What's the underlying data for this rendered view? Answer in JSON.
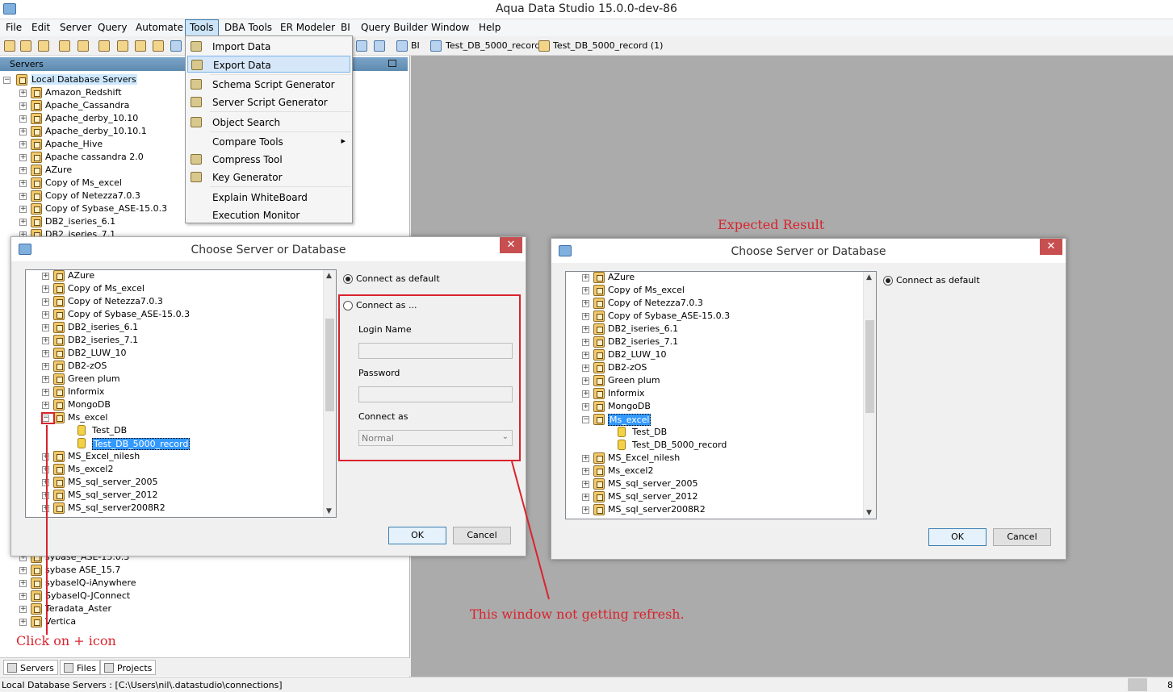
{
  "app": {
    "title": "Aqua Data Studio 15.0.0-dev-86"
  },
  "menubar": [
    "File",
    "Edit",
    "Server",
    "Query",
    "Automate",
    "Tools",
    "DBA Tools",
    "ER Modeler",
    "BI",
    "Query Builder",
    "Window",
    "Help"
  ],
  "toolbar": {
    "bi_label": "BI",
    "tab1": "Test_DB_5000_record",
    "tab2": "Test_DB_5000_record (1)"
  },
  "servers_panel": {
    "title": "Servers",
    "root": "Local Database Servers",
    "items_top": [
      "Amazon_Redshift",
      "Apache_Cassandra",
      "Apache_derby_10.10",
      "Apache_derby_10.10.1",
      "Apache_Hive",
      "Apache cassandra 2.0",
      "AZure",
      "Copy of Ms_excel",
      "Copy of Netezza7.0.3",
      "Copy of Sybase_ASE-15.0.3",
      "DB2_iseries_6.1",
      "DB2_iseries_7.1"
    ],
    "items_bottom": [
      "sybase_ASE-15.0.3",
      "sybase ASE_15.7",
      "sybaseIQ-iAnywhere",
      "SybaseIQ-JConnect",
      "Teradata_Aster",
      "Vertica"
    ]
  },
  "tools_menu": {
    "items": [
      "Import Data",
      "Export Data",
      "Schema Script Generator",
      "Server Script Generator",
      "Object Search",
      "Compare Tools",
      "Compress Tool",
      "Key Generator",
      "Explain WhiteBoard",
      "Execution Monitor"
    ],
    "submenu_arrow": "▸"
  },
  "dialog_left": {
    "title": "Choose Server or Database",
    "close": "✕",
    "tree": [
      "AZure",
      "Copy of Ms_excel",
      "Copy of Netezza7.0.3",
      "Copy of Sybase_ASE-15.0.3",
      "DB2_iseries_6.1",
      "DB2_iseries_7.1",
      "DB2_LUW_10",
      "DB2-zOS",
      "Green plum",
      "Informix",
      "MongoDB",
      "Ms_excel",
      "Test_DB",
      "Test_DB_5000_record",
      "MS_Excel_nilesh",
      "Ms_excel2",
      "MS_sql_server_2005",
      "MS_sql_server_2012",
      "MS_sql_server2008R2"
    ],
    "connect_default": "Connect as default",
    "connect_as": "Connect as ...",
    "login_label": "Login Name",
    "password_label": "Password",
    "connect_as_label": "Connect as",
    "connect_as_value": "Normal",
    "ok": "OK",
    "cancel": "Cancel"
  },
  "dialog_right": {
    "title": "Choose Server or Database",
    "close": "✕",
    "tree": [
      "AZure",
      "Copy of Ms_excel",
      "Copy of Netezza7.0.3",
      "Copy of Sybase_ASE-15.0.3",
      "DB2_iseries_6.1",
      "DB2_iseries_7.1",
      "DB2_LUW_10",
      "DB2-zOS",
      "Green plum",
      "Informix",
      "MongoDB",
      "Ms_excel",
      "Test_DB",
      "Test_DB_5000_record",
      "MS_Excel_nilesh",
      "Ms_excel2",
      "MS_sql_server_2005",
      "MS_sql_server_2012",
      "MS_sql_server2008R2"
    ],
    "connect_default": "Connect as default",
    "ok": "OK",
    "cancel": "Cancel"
  },
  "annotations": {
    "expected": "Expected Result",
    "click_plus": "Click on + icon",
    "not_refresh": "This window not getting refresh."
  },
  "bottom_tabs": [
    "Servers",
    "Files",
    "Projects"
  ],
  "status": {
    "path": "Local Database Servers : [C:\\Users\\nil\\.datastudio\\connections]",
    "right": "8"
  },
  "colors": {
    "annotation_red": "#d9232d",
    "selection": "#3399ff",
    "panel_header": "#6f98bd"
  }
}
